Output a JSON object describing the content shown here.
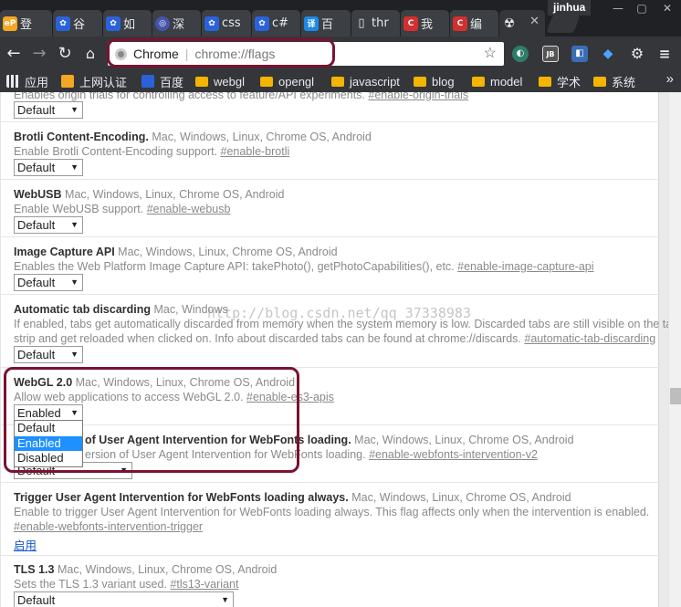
{
  "tabs": [
    {
      "favicon_text": "eP",
      "favicon_color": "#f5a623",
      "label": "登"
    },
    {
      "favicon_text": "🐾",
      "favicon_color": "#2b62d9",
      "label": "谷"
    },
    {
      "favicon_text": "🐾",
      "favicon_color": "#2b62d9",
      "label": "如"
    },
    {
      "favicon_text": "◎",
      "favicon_color": "#4455aa",
      "label": "深"
    },
    {
      "favicon_text": "🐾",
      "favicon_color": "#2b62d9",
      "label": "css"
    },
    {
      "favicon_text": "🐾",
      "favicon_color": "#2b62d9",
      "label": "c#"
    },
    {
      "favicon_text": "译",
      "favicon_color": "#1e88e5",
      "label": "百"
    },
    {
      "favicon_text": "▯",
      "favicon_color": "#3c3f43",
      "label": "thr"
    },
    {
      "favicon_text": "C",
      "favicon_color": "#d32f2f",
      "label": "我"
    },
    {
      "favicon_text": "C",
      "favicon_color": "#d32f2f",
      "label": "编"
    },
    {
      "favicon_text": "☢",
      "favicon_color": "#35363a",
      "label": ""
    }
  ],
  "profile_name": "jinhua",
  "omnibox": {
    "site": "Chrome",
    "url": "chrome://flags"
  },
  "bookmarks": [
    {
      "label": "应用",
      "kind": "apps"
    },
    {
      "label": "上网认证",
      "kind": "eP"
    },
    {
      "label": "百度",
      "kind": "baidu"
    },
    {
      "label": "webgl",
      "kind": "folder"
    },
    {
      "label": "opengl",
      "kind": "folder"
    },
    {
      "label": "javascript",
      "kind": "folder"
    },
    {
      "label": "blog",
      "kind": "folder"
    },
    {
      "label": "model",
      "kind": "folder"
    },
    {
      "label": "学术",
      "kind": "folder"
    },
    {
      "label": "系统",
      "kind": "folder"
    }
  ],
  "bookmarks_more": "»",
  "experiments": [
    {
      "name": "",
      "platforms": "",
      "desc": "Enables origin trials for controlling access to feature/API experiments. ",
      "anchor": "#enable-origin-trials",
      "select": "Default"
    },
    {
      "name": "Brotli Content-Encoding.",
      "platforms": "Mac, Windows, Linux, Chrome OS, Android",
      "desc": "Enable Brotli Content-Encoding support. ",
      "anchor": "#enable-brotli",
      "select": "Default"
    },
    {
      "name": "WebUSB",
      "platforms": "Mac, Windows, Linux, Chrome OS, Android",
      "desc": "Enable WebUSB support. ",
      "anchor": "#enable-webusb",
      "select": "Default"
    },
    {
      "name": "Image Capture API",
      "platforms": "Mac, Windows, Linux, Chrome OS, Android",
      "desc": "Enables the Web Platform Image Capture API: takePhoto(), getPhotoCapabilities(), etc. ",
      "anchor": "#enable-image-capture-api",
      "select": "Default"
    },
    {
      "name": "Automatic tab discarding",
      "platforms": "Mac, Windows",
      "desc": "If enabled, tabs get automatically discarded from memory when the system memory is low. Discarded tabs are still visible on the tab",
      "desc2": "strip and get reloaded when clicked on. Info about discarded tabs can be found at chrome://discards. ",
      "anchor": "#automatic-tab-discarding",
      "select": "Default"
    },
    {
      "name": "WebGL 2.0",
      "platforms": "Mac, Windows, Linux, Chrome OS, Android",
      "desc": "Allow web applications to access WebGL 2.0. ",
      "anchor": "#enable-es3-apis",
      "select": "Enabled"
    },
    {
      "name": "of User Agent Intervention for WebFonts loading.",
      "platforms": "Mac, Windows, Linux, Chrome OS, Android",
      "desc": "ersion of User Agent Intervention for WebFonts loading. ",
      "anchor": "#enable-webfonts-intervention-v2",
      "select": "Default"
    },
    {
      "name": "Trigger User Agent Intervention for WebFonts loading always.",
      "platforms": "Mac, Windows, Linux, Chrome OS, Android",
      "desc": "Enable to trigger User Agent Intervention for WebFonts loading always. This flag affects only when the intervention is enabled.",
      "desc2": "#enable-webfonts-intervention-trigger",
      "link": "启用"
    },
    {
      "name": "TLS 1.3",
      "platforms": "Mac, Windows, Linux, Chrome OS, Android",
      "desc": "Sets the TLS 1.3 variant used. ",
      "anchor": "#tls13-variant",
      "select": "Default"
    }
  ],
  "dropdown_options": [
    "Default",
    "Enabled",
    "Disabled"
  ],
  "dropdown_selected": "Enabled",
  "watermark": "http://blog.csdn.net/qq_37338983",
  "colors": {
    "highlight_ring": "#7b1230",
    "selected_option": "#1e90ff",
    "link": "#1155cc"
  }
}
